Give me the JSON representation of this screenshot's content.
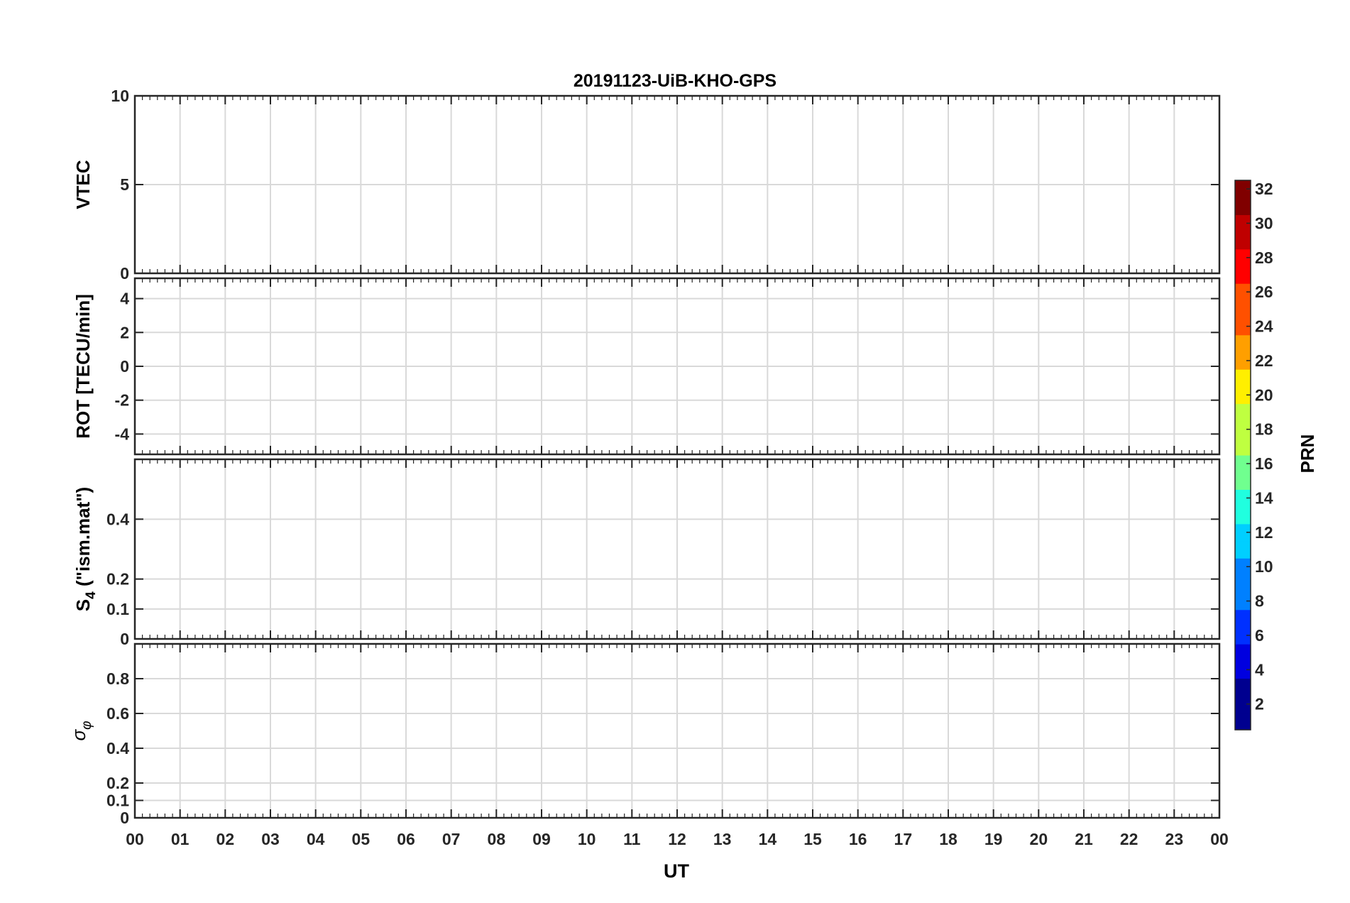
{
  "title": "20191123-UiB-KHO-GPS",
  "colors": [
    "#00008f",
    "#0000df",
    "#0030ff",
    "#0080ff",
    "#00cfff",
    "#20ffdf",
    "#70ff8f",
    "#bfff40",
    "#ffef00",
    "#ff9f00",
    "#ff5000",
    "#ff0000",
    "#bf0000",
    "#800000"
  ],
  "chart_data": [
    {
      "type": "line",
      "ylabel": "VTEC",
      "ylim": [
        0,
        10
      ],
      "yticks": [
        0,
        5,
        10
      ],
      "ytick_labels": [
        "0",
        "5",
        "10"
      ],
      "grid": true
    },
    {
      "type": "line",
      "ylabel": "ROT [TECU/min]",
      "ylim": [
        -5.2,
        5.2
      ],
      "yticks": [
        -4,
        -2,
        0,
        2,
        4
      ],
      "ytick_labels": [
        "-4",
        "-2",
        "0",
        "2",
        "4"
      ],
      "grid": true
    },
    {
      "type": "line",
      "ylabel_main": "S",
      "ylabel_sub": "4",
      "ylabel_rest": " (\"ism.mat\")",
      "ylim": [
        0,
        0.6
      ],
      "yticks": [
        0,
        0.1,
        0.2,
        0.4
      ],
      "ytick_labels": [
        "0",
        "0.1",
        "0.2",
        "0.4"
      ],
      "grid": true
    },
    {
      "type": "line",
      "ylabel_main": "σ",
      "ylabel_sub": "φ",
      "ylim": [
        0,
        1
      ],
      "yticks": [
        0,
        0.1,
        0.2,
        0.4,
        0.6,
        0.8
      ],
      "ytick_labels": [
        "0",
        "0.1",
        "0.2",
        "0.4",
        "0.6",
        "0.8"
      ],
      "grid": true
    }
  ],
  "xaxis": {
    "label": "UT",
    "range": [
      0,
      24
    ],
    "tick_labels": [
      "00",
      "01",
      "02",
      "03",
      "04",
      "05",
      "06",
      "07",
      "08",
      "09",
      "10",
      "11",
      "12",
      "13",
      "14",
      "15",
      "16",
      "17",
      "18",
      "19",
      "20",
      "21",
      "22",
      "23",
      "00"
    ]
  },
  "colorbar": {
    "label": "PRN",
    "range": [
      1,
      32
    ],
    "tick_labels": [
      "2",
      "4",
      "6",
      "8",
      "10",
      "12",
      "14",
      "16",
      "18",
      "20",
      "22",
      "24",
      "26",
      "28",
      "30",
      "32"
    ]
  }
}
